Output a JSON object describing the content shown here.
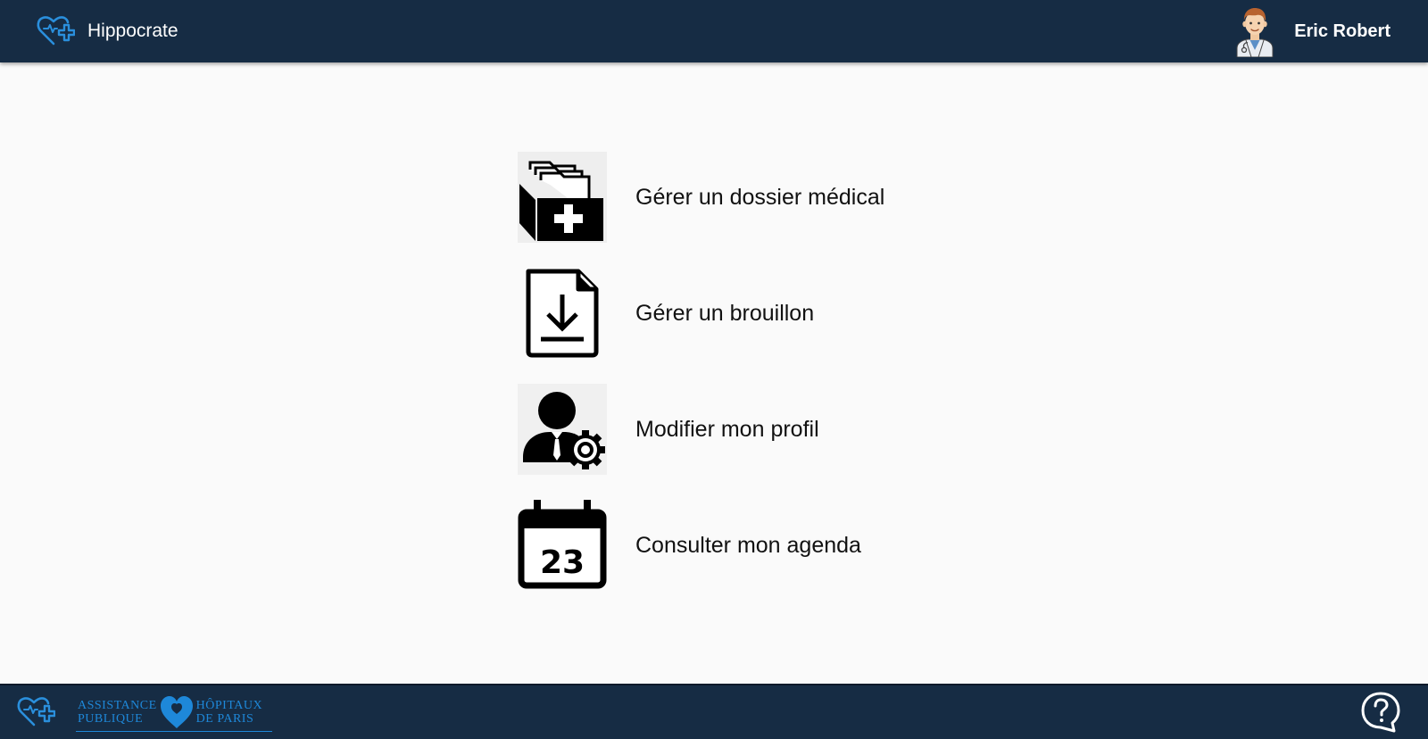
{
  "header": {
    "app_name": "Hippocrate",
    "user_name": "Eric Robert",
    "logo_icon": "heart-cross-icon",
    "avatar_icon": "doctor-avatar-icon"
  },
  "menu": {
    "items": [
      {
        "label": "Gérer un dossier médical",
        "icon": "medical-folder-icon"
      },
      {
        "label": "Gérer un brouillon",
        "icon": "document-download-icon"
      },
      {
        "label": "Modifier mon profil",
        "icon": "user-settings-icon"
      },
      {
        "label": "Consulter mon agenda",
        "icon": "calendar-icon",
        "calendar_day": "23"
      }
    ]
  },
  "footer": {
    "aphp_line1_left": "ASSISTANCE",
    "aphp_line2_left": "PUBLIQUE",
    "aphp_line1_right": "HÔPITAUX",
    "aphp_line2_right": "DE PARIS",
    "help_icon": "help-bubble-icon"
  },
  "colors": {
    "header_bg": "#162c44",
    "page_bg": "#fafafa",
    "accent_blue": "#1e88d9",
    "text": "#111111"
  }
}
